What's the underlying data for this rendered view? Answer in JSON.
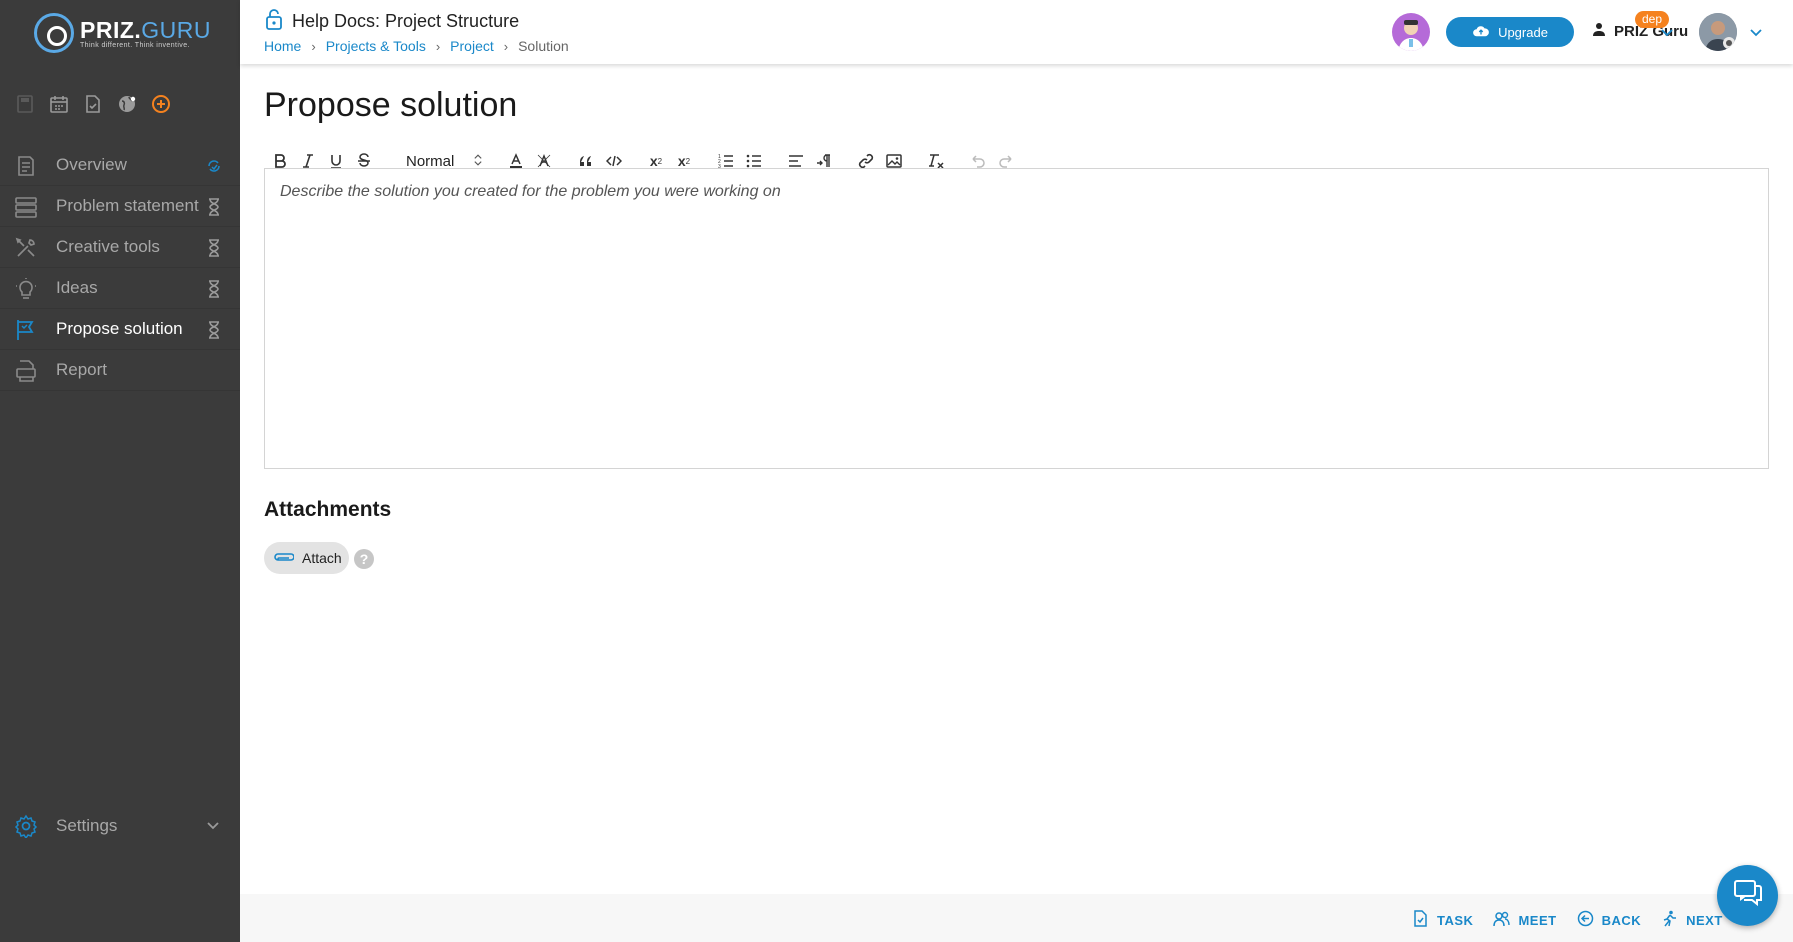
{
  "app": {
    "logo_name_left": "PRIZ.",
    "logo_name_right": "GURU",
    "logo_tagline": "Think different. Think inventive."
  },
  "colors": {
    "accent": "#1a88c9",
    "sidebar_bg": "#3b3b3b",
    "badge_orange": "#f5821f",
    "add_orange": "#f5821f"
  },
  "quick_icons": [
    "save-icon",
    "calendar-icon",
    "task-file-icon",
    "globe-icon",
    "add-circle-icon"
  ],
  "sidebar": {
    "items": [
      {
        "label": "Overview",
        "icon": "overview-icon",
        "status": "sync-icon",
        "active": false
      },
      {
        "label": "Problem statement",
        "icon": "problem-statement-icon",
        "status": "hourglass-icon",
        "active": false
      },
      {
        "label": "Creative tools",
        "icon": "tools-icon",
        "status": "hourglass-icon",
        "active": false
      },
      {
        "label": "Ideas",
        "icon": "lightbulb-icon",
        "status": "hourglass-icon",
        "active": false
      },
      {
        "label": "Propose solution",
        "icon": "flag-icon",
        "status": "hourglass-icon",
        "active": true
      },
      {
        "label": "Report",
        "icon": "pdf-report-icon",
        "status": "",
        "active": false
      }
    ],
    "settings_label": "Settings"
  },
  "header": {
    "title": "Help Docs: Project Structure",
    "breadcrumb": {
      "home": "Home",
      "projects": "Projects & Tools",
      "project": "Project",
      "current": "Solution"
    },
    "upgrade_label": "Upgrade",
    "user_name": "PRIZ Guru",
    "badge": "dep"
  },
  "main": {
    "title": "Propose solution",
    "toolbar": {
      "format_select": "Normal",
      "subscript": "x",
      "subscript_mark": "2",
      "superscript": "x",
      "superscript_mark": "2"
    },
    "editor_placeholder": "Describe the solution you created for the problem you were working on",
    "attachments_heading": "Attachments",
    "attach_label": "Attach",
    "help_mark": "?"
  },
  "footer": {
    "task": "TASK",
    "meet": "MEET",
    "back": "BACK",
    "next": "NEXT"
  }
}
